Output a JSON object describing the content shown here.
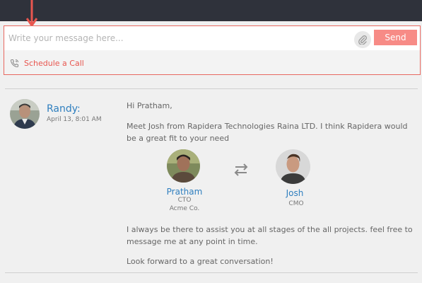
{
  "composer": {
    "placeholder": "Write your message here...",
    "send_label": "Send",
    "schedule_label": "Schedule a Call"
  },
  "message": {
    "sender": "Randy:",
    "timestamp": "April 13, 8:01 AM",
    "greeting": "Hi Pratham,",
    "intro": "Meet Josh from Rapidera Technologies Raina LTD. I think Rapidera would be a great fit to your need",
    "left_person": {
      "name": "Pratham",
      "title": "CTO",
      "company": "Acme Co."
    },
    "right_person": {
      "name": "Josh",
      "title": "CMO"
    },
    "assist": "I always be there to assist you at all stages of the all projects. feel free to message me at any point in time.",
    "closing": "Look forward to a great conversation!"
  },
  "colors": {
    "topbar": "#2f323b",
    "accent_red": "#e8564f",
    "send_button": "#f78b86",
    "link_blue": "#2f7fbf"
  },
  "icons": [
    "down-arrow-icon",
    "paperclip-icon",
    "phone-icon",
    "swap-arrows-icon"
  ]
}
